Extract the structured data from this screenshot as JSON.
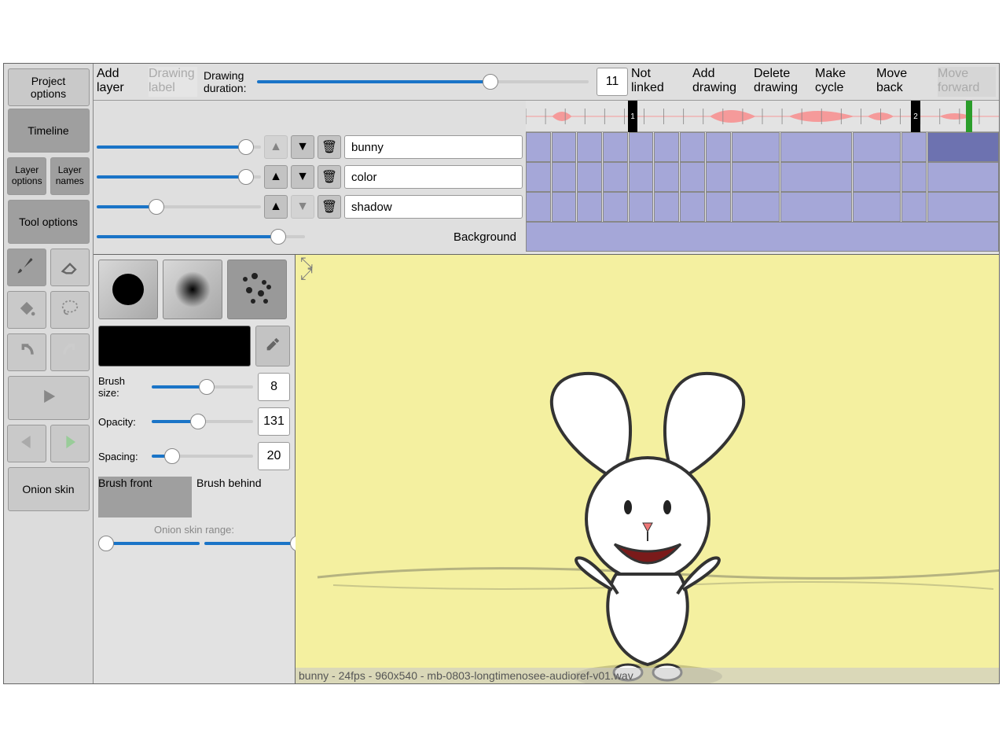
{
  "sidebar": {
    "project_options": "Project\noptions",
    "timeline": "Timeline",
    "layer_options": "Layer\noptions",
    "layer_names": "Layer\nnames",
    "tool_options": "Tool options",
    "onion_skin": "Onion skin"
  },
  "topbar": {
    "add_layer": "Add\nlayer",
    "drawing_label": "Drawing\nlabel",
    "drawing_duration": "Drawing\nduration:",
    "duration_value": "11",
    "not_linked": "Not\nlinked",
    "add_drawing": "Add\ndrawing",
    "delete_drawing": "Delete\ndrawing",
    "make_cycle": "Make\ncycle",
    "move_back": "Move\nback",
    "move_forward": "Move\nforward"
  },
  "layers": [
    {
      "name": "bunny"
    },
    {
      "name": "color"
    },
    {
      "name": "shadow"
    }
  ],
  "background_label": "Background",
  "markers": {
    "m1": "1",
    "m2": "2"
  },
  "tool": {
    "brush_size_label": "Brush size:",
    "brush_size": "8",
    "opacity_label": "Opacity:",
    "opacity": "131",
    "spacing_label": "Spacing:",
    "spacing": "20",
    "brush_front": "Brush front",
    "brush_behind": "Brush behind",
    "onion_skin_range": "Onion skin range:"
  },
  "status": "bunny - 24fps - 960x540 - mb-0803-longtimenosee-audioref-v01.wav"
}
